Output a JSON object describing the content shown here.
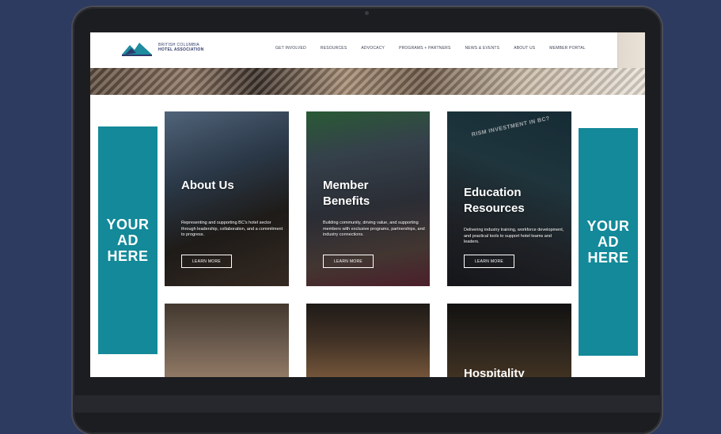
{
  "site": {
    "logo_line1": "BRITISH COLUMBIA",
    "logo_line2": "HOTEL ASSOCIATION"
  },
  "nav": {
    "items": [
      "GET INVOLVED",
      "RESOURCES",
      "ADVOCACY",
      "PROGRAMS + PARTNERS",
      "NEWS & EVENTS",
      "ABOUT US",
      "MEMBER PORTAL"
    ]
  },
  "ads": {
    "left": "YOUR AD HERE",
    "right": "YOUR AD HERE"
  },
  "cards": [
    {
      "title": "About Us",
      "description": "Representing and supporting BC's hotel sector through leadership, collaboration, and a commitment to progress.",
      "button": "LEARN MORE"
    },
    {
      "title": "Member Benefits",
      "description": "Building community, driving value, and supporting members with exclusive programs, partnerships, and industry connections.",
      "button": "LEARN MORE"
    },
    {
      "title": "Education Resources",
      "description": "Delivering industry training, workforce development, and practical tools to support hotel teams and leaders.",
      "button": "LEARN MORE",
      "sign_text": "RISM INVESTMENT IN BC?"
    },
    {
      "title": "Hospitality"
    }
  ],
  "colors": {
    "background": "#2e3b61",
    "ad_teal": "#138999",
    "logo_navy": "#2f3a6b"
  }
}
